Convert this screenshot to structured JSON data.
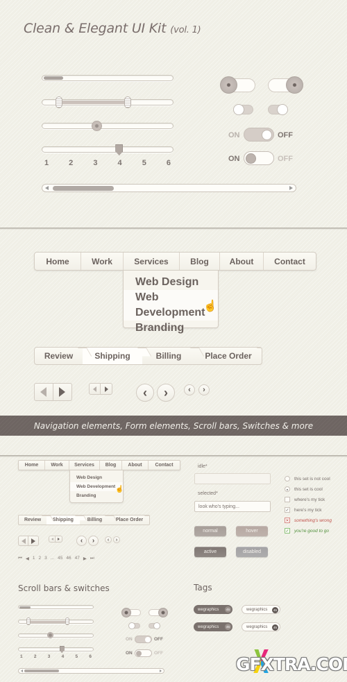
{
  "header": {
    "title": "Clean & Elegant UI Kit",
    "volume": "(vol. 1)"
  },
  "sliders": {
    "progress_fraction": 0.15,
    "range": {
      "low": 0.1,
      "high": 0.63
    },
    "single_value_fraction": 0.38,
    "stepped": {
      "value": 4,
      "ticks": [
        "1",
        "2",
        "3",
        "4",
        "5",
        "6"
      ]
    }
  },
  "toggles": {
    "big": [
      {
        "state": "off"
      },
      {
        "state": "on"
      }
    ],
    "small": [
      {
        "state": "off"
      },
      {
        "state": "on"
      }
    ],
    "onoff": [
      {
        "on_label": "ON",
        "off_label": "OFF",
        "state": "off"
      },
      {
        "on_label": "ON",
        "off_label": "OFF",
        "state": "on"
      }
    ]
  },
  "scrollbar": {
    "thumb_fraction": 0.24
  },
  "nav": {
    "items": [
      "Home",
      "Work",
      "Services",
      "Blog",
      "About",
      "Contact"
    ],
    "open_item": "Services",
    "dropdown": [
      "Web Design",
      "Web Development",
      "Branding"
    ],
    "hovered": "Web Development",
    "cursor": "pointer-hand-icon"
  },
  "steps": {
    "items": [
      "Review",
      "Shipping",
      "Billing",
      "Place Order"
    ],
    "active": "Shipping"
  },
  "arrows": {
    "prev_glyph": "‹",
    "next_glyph": "›"
  },
  "banner": {
    "text": "Navigation elements, Form elements, Scroll bars, Switches & more"
  },
  "pagination": {
    "first": "⏮",
    "prev": "◀",
    "pages": [
      "1",
      "2",
      "3",
      "...",
      "45",
      "46",
      "47"
    ],
    "next": "▶",
    "last": "⏭"
  },
  "form": {
    "idle_label": "idle*",
    "idle_value": "",
    "selected_label": "selected*",
    "selected_value": "look who's typing...",
    "buttons": [
      {
        "label": "normal",
        "color": "#a69d98"
      },
      {
        "label": "hover",
        "color": "#b6a8a2"
      },
      {
        "label": "active",
        "color": "#7f7773"
      },
      {
        "label": "disabled",
        "color": "#a3a2a4"
      }
    ]
  },
  "checks": [
    {
      "type": "radio",
      "checked": false,
      "label": "this set is not cool",
      "color": "#776e6a"
    },
    {
      "type": "radio",
      "checked": true,
      "label": "this set is cool",
      "color": "#776e6a"
    },
    {
      "type": "checkbox",
      "checked": false,
      "label": "where's my tick",
      "color": "#776e6a"
    },
    {
      "type": "checkbox",
      "checked": true,
      "label": "here's my tick",
      "color": "#776e6a"
    },
    {
      "type": "checkbox",
      "error": true,
      "label": "something's wrong",
      "color": "#c0504a"
    },
    {
      "type": "checkbox",
      "success": true,
      "label": "you're good to go",
      "color": "#4f8f3a"
    }
  ],
  "scroll_section": {
    "heading": "Scroll bars & switches"
  },
  "tags": {
    "heading": "Tags",
    "items": [
      {
        "label": "wegraphics",
        "count": "45",
        "style": "dark"
      },
      {
        "label": "wegraphics",
        "count": "45",
        "style": "light"
      },
      {
        "label": "wegraphics",
        "count": "45",
        "style": "dark"
      },
      {
        "label": "wegraphics",
        "count": "45",
        "style": "light"
      }
    ]
  },
  "watermark": {
    "text": "GFXTRA.COM"
  }
}
